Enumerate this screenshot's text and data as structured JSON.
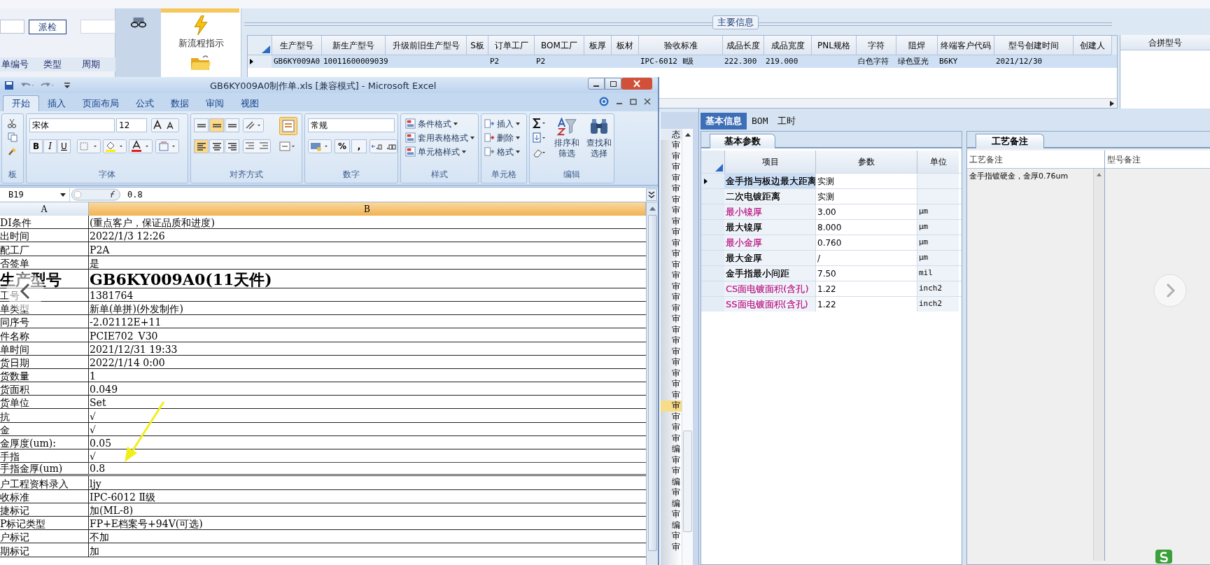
{
  "left_app": {
    "button": "派检",
    "columns": [
      "单编号",
      "类型",
      "周期"
    ]
  },
  "launcher": {
    "items": [
      {
        "kind": "bolt",
        "label": "新流程指示"
      },
      {
        "kind": "folder"
      }
    ]
  },
  "main_grid": {
    "section_title": "主要信息",
    "columns": [
      "生产型号",
      "新生产型号",
      "升级前旧生产型号",
      "S板",
      "订单工厂",
      "BOM工厂",
      "板厚",
      "板材",
      "验收标准",
      "成品长度",
      "成品宽度",
      "PNL规格",
      "字符",
      "阻焊",
      "终端客户代码",
      "型号创建时间",
      "创建人"
    ],
    "rows": [
      {
        "selected": true,
        "cells": [
          "GB6KY009A0",
          "10011600009039",
          null,
          null,
          "P2",
          "P2",
          null,
          null,
          "IPC-6012 Ⅱ级",
          "222.300",
          "219.000",
          null,
          "白色字符",
          "绿色亚光",
          "B6KY",
          "2021/12/30",
          null
        ]
      }
    ],
    "side_column": "合拼型号"
  },
  "excel": {
    "title": "GB6KY009A0制作单.xls  [兼容模式] - Microsoft Excel",
    "tabs": [
      {
        "label": "开始",
        "selected": true
      },
      {
        "label": "插入",
        "selected": false
      },
      {
        "label": "页面布局",
        "selected": false
      },
      {
        "label": "公式",
        "selected": false
      },
      {
        "label": "数据",
        "selected": false
      },
      {
        "label": "审阅",
        "selected": false
      },
      {
        "label": "视图",
        "selected": false
      }
    ],
    "ribbon": {
      "clipboard_label": "板",
      "font": "宋体",
      "font_size": "12",
      "format_buttons": [
        "B",
        "I",
        "U"
      ],
      "font_label": "字体",
      "align_label": "对齐方式",
      "number_format": "常规",
      "number_buttons": [
        "%",
        ","
      ],
      "number_label": "数字",
      "styles": [
        "条件格式",
        "套用表格格式",
        "单元格样式"
      ],
      "styles_label": "样式",
      "cells": [
        "插入",
        "删除",
        "格式"
      ],
      "cells_label": "单元格",
      "editing": [
        {
          "top": "排序和",
          "bottom": "筛选"
        },
        {
          "top": "查找和",
          "bottom": "选择"
        }
      ],
      "editing_label": "编辑"
    },
    "name_box": "B19",
    "formula": "0.8",
    "columns": [
      "A",
      "B"
    ],
    "rows": [
      {
        "a": "DI条件",
        "b": "(重点客户，保证品质和进度)",
        "kind": "normal",
        "selected": false
      },
      {
        "a": "出时间",
        "b": "2022/1/3 12:26",
        "kind": "normal",
        "selected": false
      },
      {
        "a": "配工厂",
        "b": "P2A",
        "kind": "normal",
        "selected": false
      },
      {
        "a": "否签单",
        "b": "是",
        "kind": "normal",
        "selected": false
      },
      {
        "a": "生产型号",
        "b": "GB6KY009A0(11天件)",
        "kind": "title",
        "selected": false
      },
      {
        "a": "工号",
        "b": "1381764",
        "kind": "normal",
        "selected": false
      },
      {
        "a": "单类型",
        "b": "新单(单拼)(外发制作)",
        "kind": "normal",
        "selected": false
      },
      {
        "a": "同序号",
        "b": "-2.02112E+11",
        "kind": "normal",
        "selected": false
      },
      {
        "a": "件名称",
        "b": "PCIE702_V30",
        "kind": "normal",
        "selected": false
      },
      {
        "a": "单时间",
        "b": "2021/12/31 19:33",
        "kind": "normal",
        "selected": false
      },
      {
        "a": "货日期",
        "b": "2022/1/14 0:00",
        "kind": "normal",
        "selected": false
      },
      {
        "a": "货数量",
        "b": "1",
        "kind": "normal",
        "selected": false
      },
      {
        "a": "货面积",
        "b": "0.049",
        "kind": "normal",
        "selected": false
      },
      {
        "a": "货单位",
        "b": "Set",
        "kind": "normal",
        "selected": false
      },
      {
        "a": "抗",
        "b": "√",
        "kind": "normal",
        "selected": false
      },
      {
        "a": "金",
        "b": "√",
        "kind": "normal",
        "selected": false
      },
      {
        "a": "金厚度(um):",
        "b": "0.05",
        "kind": "normal",
        "selected": false
      },
      {
        "a": "手指",
        "b": "√",
        "kind": "normal",
        "selected": false
      },
      {
        "a": "手指金厚(um)",
        "b": "0.8",
        "kind": "normal",
        "selected": true
      },
      {
        "a": "户工程资料录入",
        "b": "ljy",
        "kind": "normal",
        "selected": false
      },
      {
        "a": "收标准",
        "b": "IPC-6012 Ⅱ级",
        "kind": "normal",
        "selected": false
      },
      {
        "a": "捷标记",
        "b": "加(ML-8)",
        "kind": "normal",
        "selected": false
      },
      {
        "a": "P标记类型",
        "b": "FP+E档案号+94V(可选)",
        "kind": "normal",
        "selected": false
      },
      {
        "a": "户标记",
        "b": "不加",
        "kind": "normal",
        "selected": false
      },
      {
        "a": "期标记",
        "b": "加",
        "kind": "normal",
        "selected": false
      }
    ]
  },
  "status_strip": {
    "header": "态",
    "rows": [
      {
        "text": "审",
        "selected": false
      },
      {
        "text": "审",
        "selected": false
      },
      {
        "text": "审",
        "selected": false
      },
      {
        "text": "审",
        "selected": false
      },
      {
        "text": "审",
        "selected": false
      },
      {
        "text": "审",
        "selected": false
      },
      {
        "text": "审",
        "selected": false
      },
      {
        "text": "审",
        "selected": false
      },
      {
        "text": "审",
        "selected": false
      },
      {
        "text": "审",
        "selected": false
      },
      {
        "text": "审",
        "selected": false
      },
      {
        "text": "审",
        "selected": false
      },
      {
        "text": "审",
        "selected": false
      },
      {
        "text": "审",
        "selected": false
      },
      {
        "text": "审",
        "selected": false
      },
      {
        "text": "审",
        "selected": false
      },
      {
        "text": "审",
        "selected": false
      },
      {
        "text": "审",
        "selected": false
      },
      {
        "text": "审",
        "selected": false
      },
      {
        "text": "审",
        "selected": false
      },
      {
        "text": "审",
        "selected": false
      },
      {
        "text": "审",
        "selected": false
      },
      {
        "text": "审",
        "selected": false
      },
      {
        "text": "审",
        "selected": false
      },
      {
        "text": "审",
        "selected": true
      },
      {
        "text": "审",
        "selected": false
      },
      {
        "text": "审",
        "selected": false
      },
      {
        "text": "审",
        "selected": false
      },
      {
        "text": "编",
        "selected": false
      },
      {
        "text": "审",
        "selected": false
      },
      {
        "text": "审",
        "selected": false
      },
      {
        "text": "编",
        "selected": false
      },
      {
        "text": "审",
        "selected": false
      },
      {
        "text": "编",
        "selected": false
      },
      {
        "text": "审",
        "selected": false
      },
      {
        "text": "编",
        "selected": false
      },
      {
        "text": "审",
        "selected": false
      },
      {
        "text": "审",
        "selected": false
      }
    ]
  },
  "detail": {
    "tabs": [
      {
        "label": "基本信息",
        "selected": true
      },
      {
        "label": "BOM",
        "selected": false
      },
      {
        "label": "工时",
        "selected": false
      }
    ],
    "params": {
      "tab": "基本参数",
      "columns": [
        "项目",
        "参数",
        "单位"
      ],
      "rows": [
        {
          "item": "金手指与板边最大距离",
          "value": "实测",
          "unit": null,
          "color": "#000000",
          "selected": true
        },
        {
          "item": "二次电镀距离",
          "value": "实测",
          "unit": null,
          "color": "#000000",
          "selected": false
        },
        {
          "item": "最小镍厚",
          "value": "3.00",
          "unit": "μm",
          "color": "#c0288c",
          "selected": false
        },
        {
          "item": "最大镍厚",
          "value": "8.000",
          "unit": "μm",
          "color": "#000000",
          "selected": false
        },
        {
          "item": "最小金厚",
          "value": "0.760",
          "unit": "μm",
          "color": "#c0288c",
          "selected": false
        },
        {
          "item": "最大金厚",
          "value": "/",
          "unit": "μm",
          "color": "#000000",
          "selected": false
        },
        {
          "item": "金手指最小间距",
          "value": "7.50",
          "unit": "mil",
          "color": "#000000",
          "selected": false
        },
        {
          "item": "CS面电镀面积(含孔)",
          "value": "1.22",
          "unit": "inch2",
          "color": "#c0288c",
          "selected": false
        },
        {
          "item": "SS面电镀面积(含孔)",
          "value": "1.22",
          "unit": "inch2",
          "color": "#c0288c",
          "selected": false
        }
      ]
    },
    "notes": {
      "tab": "工艺备注",
      "columns": [
        "工艺备注",
        "型号备注"
      ],
      "text": "金手指镀硬金，金厚0.76um"
    }
  }
}
